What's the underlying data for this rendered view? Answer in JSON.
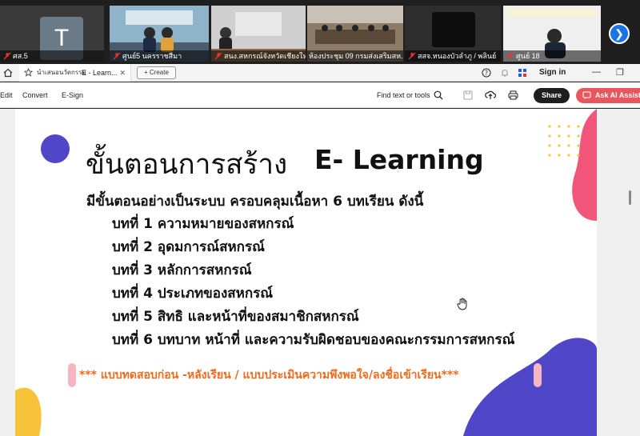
{
  "participants": [
    {
      "name": "",
      "avatar_letter": "T"
    },
    {
      "name": "ศส.5",
      "avatar_letter": ""
    },
    {
      "name": "ศูนย์5 นครราชสีมา",
      "avatar_letter": ""
    },
    {
      "name": "สนง.สหกรณ์จังหวัดเชียงใหม่",
      "avatar_letter": ""
    },
    {
      "name": "ห้องประชุม 09 กรมส่งเสริมสห...",
      "avatar_letter": ""
    },
    {
      "name": "สสจ.หนองบัวลำภู / พลินย์",
      "avatar_letter": ""
    },
    {
      "name": "ศูนย์ 18",
      "avatar_letter": ""
    }
  ],
  "browser": {
    "tab_title_thai": "นำเสนอนวัตกรรม",
    "tab_title": "E - Learn...",
    "create_label": "Create",
    "signin_label": "Sign in"
  },
  "toolbar": {
    "edit_label": "Edit",
    "convert_label": "Convert",
    "esign_label": "E-Sign",
    "find_label": "Find text or tools",
    "share_label": "Share",
    "ai_label": "Ask AI Assista"
  },
  "slide": {
    "title_thai": "ขั้นตอนการสร้าง",
    "title_en": "E- Learning",
    "intro": "มีขั้นตอนอย่างเป็นระบบ ครอบคลุมเนื้อหา 6 บทเรียน ดังนี้",
    "lessons": [
      "บทที่ 1 ความหมายของสหกรณ์",
      "บทที่ 2 อุดมการณ์สหกรณ์",
      "บทที่ 3 หลักการสหกรณ์",
      "บทที่ 4 ประเภทของสหกรณ์",
      "บทที่ 5 สิทธิ และหน้าที่ของสมาชิกสหกรณ์",
      "บทที่ 6 บทบาท หน้าที่ และความรับผิดชอบของคณะกรรมการสหกรณ์"
    ],
    "note": "*** แบบทดสอบก่อน -หลังเรียน / แบบประเมินความพึงพอใจ/ลงชื่อเข้าเรียน***"
  },
  "colors": {
    "accent_orange": "#f26a1b",
    "share_bg": "#1e1e1e",
    "ai_bg": "#e8575b",
    "active_tile": "#3fdc4b",
    "blob_blue": "#4f46c8",
    "blob_pink": "#f2557a",
    "blob_yellow": "#f7c33a"
  }
}
